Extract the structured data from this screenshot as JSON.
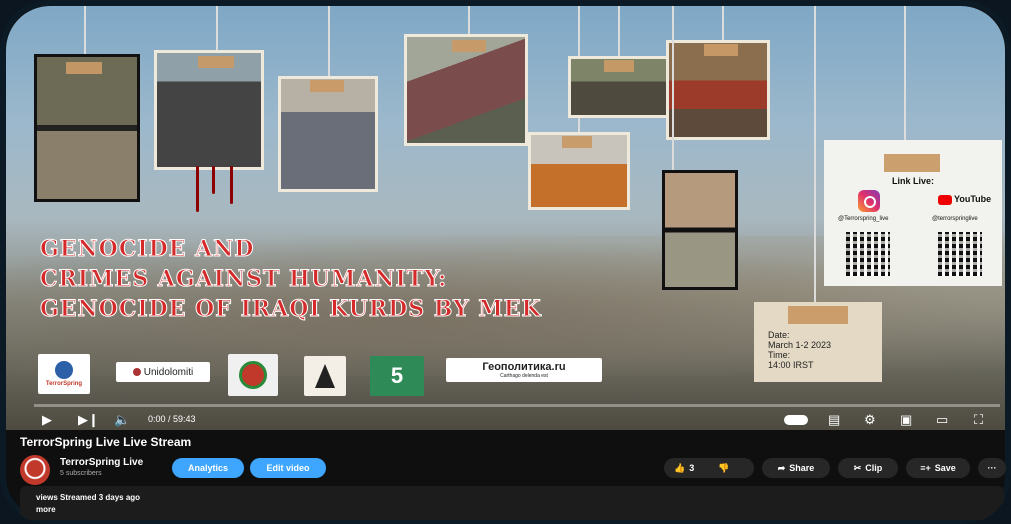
{
  "video": {
    "title_lines": [
      "GENOCIDE AND",
      "CRIMES AGAINST HUMANITY:",
      "GENOCIDE OF IRAQI KURDS BY MEK"
    ],
    "link_panel": {
      "label": "Link Live:",
      "instagram_handle": "@Terrorspring_live",
      "youtube_label": "YouTube",
      "youtube_handle": "@terrorspringlive"
    },
    "note": {
      "date_label": "Date:",
      "date_value": "March 1-2   2023",
      "time_label": "Time:",
      "time_value": "14:00 IRST"
    },
    "logos": [
      "TerrorSpring",
      "Unidolomiti",
      "",
      "",
      "",
      "Геополитика.ru",
      "Carthago delenda est"
    ],
    "player": {
      "current_time": "0:00",
      "duration": "59:43",
      "time_display": "0:00 / 59:43",
      "progress": 0
    }
  },
  "info": {
    "title": "TerrorSpring Live Live Stream",
    "channel_name": "TerrorSpring Live",
    "subscribers": "5 subscribers",
    "analytics_label": "Analytics",
    "edit_label": "Edit video",
    "like_count": "3",
    "share_label": "Share",
    "clip_label": "Clip",
    "save_label": "Save",
    "more_label": "···"
  },
  "description": {
    "meta": "views  Streamed 3 days ago",
    "more": "more"
  },
  "colors": {
    "title_red": "#d42a2a",
    "button_blue": "#3ea6ff",
    "page_bg": "#0f0f0f"
  }
}
